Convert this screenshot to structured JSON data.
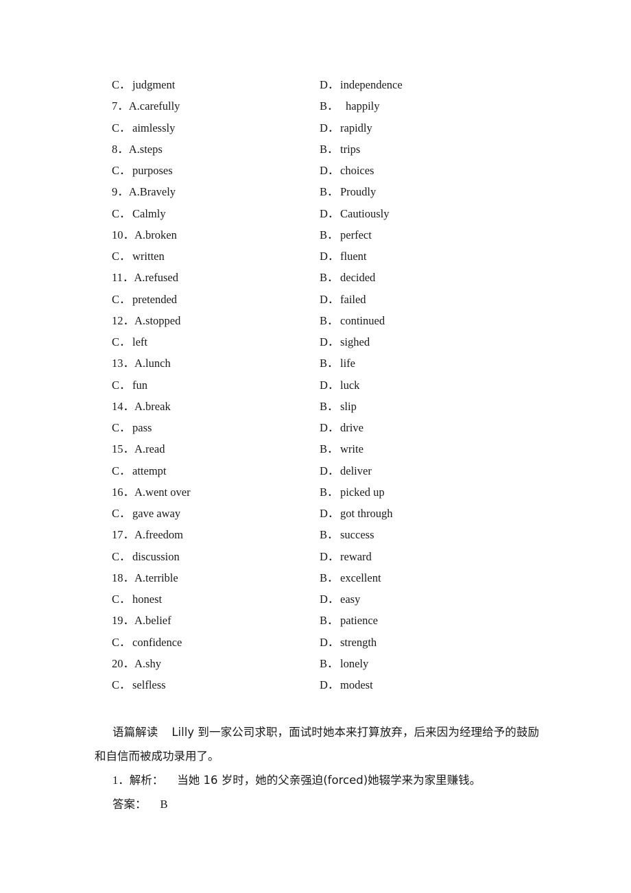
{
  "document": {
    "type": "answer-key-page",
    "background_color": "#ffffff",
    "text_color": "#1a1a1a"
  },
  "options": {
    "rows": [
      {
        "left": {
          "lead": "C．",
          "word": "judgment"
        },
        "right": {
          "lead": "D．",
          "word": "independence"
        }
      },
      {
        "left": {
          "lead": "7．A.",
          "word": "carefully",
          "numbered": true
        },
        "right": {
          "lead": "B．",
          "word": "happily",
          "extra_gap": true
        }
      },
      {
        "left": {
          "lead": "C．",
          "word": "aimlessly"
        },
        "right": {
          "lead": "D．",
          "word": "rapidly"
        }
      },
      {
        "left": {
          "lead": "8．A.",
          "word": "steps",
          "numbered": true
        },
        "right": {
          "lead": "B．",
          "word": "trips"
        }
      },
      {
        "left": {
          "lead": "C．",
          "word": "purposes"
        },
        "right": {
          "lead": "D．",
          "word": "choices"
        }
      },
      {
        "left": {
          "lead": "9．A.",
          "word": "Bravely",
          "numbered": true
        },
        "right": {
          "lead": "B．",
          "word": "Proudly"
        }
      },
      {
        "left": {
          "lead": "C．",
          "word": "Calmly"
        },
        "right": {
          "lead": "D．",
          "word": "Cautiously"
        }
      },
      {
        "left": {
          "lead": "10．A.",
          "word": "broken",
          "numbered": true,
          "two_digit": true
        },
        "right": {
          "lead": "B．",
          "word": "perfect"
        }
      },
      {
        "left": {
          "lead": "C．",
          "word": "written"
        },
        "right": {
          "lead": "D．",
          "word": "fluent"
        }
      },
      {
        "left": {
          "lead": "11．A.",
          "word": "refused",
          "numbered": true,
          "two_digit": true
        },
        "right": {
          "lead": "B．",
          "word": "decided"
        }
      },
      {
        "left": {
          "lead": "C．",
          "word": "pretended"
        },
        "right": {
          "lead": "D．",
          "word": "failed"
        }
      },
      {
        "left": {
          "lead": "12．A.",
          "word": "stopped",
          "numbered": true,
          "two_digit": true
        },
        "right": {
          "lead": "B．",
          "word": "continued"
        }
      },
      {
        "left": {
          "lead": "C．",
          "word": "left"
        },
        "right": {
          "lead": "D．",
          "word": "sighed"
        }
      },
      {
        "left": {
          "lead": "13．A.",
          "word": "lunch",
          "numbered": true,
          "two_digit": true
        },
        "right": {
          "lead": "B．",
          "word": "life"
        }
      },
      {
        "left": {
          "lead": "C．",
          "word": "fun"
        },
        "right": {
          "lead": "D．",
          "word": "luck"
        }
      },
      {
        "left": {
          "lead": "14．A.",
          "word": "break",
          "numbered": true,
          "two_digit": true
        },
        "right": {
          "lead": "B．",
          "word": "slip"
        }
      },
      {
        "left": {
          "lead": "C．",
          "word": "pass"
        },
        "right": {
          "lead": "D．",
          "word": "drive"
        }
      },
      {
        "left": {
          "lead": "15．A.",
          "word": "read",
          "numbered": true,
          "two_digit": true
        },
        "right": {
          "lead": "B．",
          "word": "write"
        }
      },
      {
        "left": {
          "lead": "C．",
          "word": "attempt"
        },
        "right": {
          "lead": "D．",
          "word": "deliver"
        }
      },
      {
        "left": {
          "lead": "16．A.",
          "word": "went over",
          "numbered": true,
          "two_digit": true
        },
        "right": {
          "lead": "B．",
          "word": "picked up"
        }
      },
      {
        "left": {
          "lead": "C．",
          "word": "gave away"
        },
        "right": {
          "lead": "D．",
          "word": "got through"
        }
      },
      {
        "left": {
          "lead": "17．A.",
          "word": "freedom",
          "numbered": true,
          "two_digit": true
        },
        "right": {
          "lead": "B．",
          "word": "success"
        }
      },
      {
        "left": {
          "lead": "C．",
          "word": "discussion"
        },
        "right": {
          "lead": "D．",
          "word": "reward"
        }
      },
      {
        "left": {
          "lead": "18．A.",
          "word": "terrible",
          "numbered": true,
          "two_digit": true
        },
        "right": {
          "lead": "B．",
          "word": "excellent"
        }
      },
      {
        "left": {
          "lead": "C．",
          "word": "honest"
        },
        "right": {
          "lead": "D．",
          "word": "easy"
        }
      },
      {
        "left": {
          "lead": "19．A.",
          "word": "belief",
          "numbered": true,
          "two_digit": true
        },
        "right": {
          "lead": "B．",
          "word": "patience"
        }
      },
      {
        "left": {
          "lead": "C．",
          "word": "confidence"
        },
        "right": {
          "lead": "D．",
          "word": "strength"
        }
      },
      {
        "left": {
          "lead": "20．A.",
          "word": "shy",
          "numbered": true,
          "two_digit": true
        },
        "right": {
          "lead": "B．",
          "word": "lonely"
        }
      },
      {
        "left": {
          "lead": "C．",
          "word": "selfless"
        },
        "right": {
          "lead": "D．",
          "word": "modest"
        }
      }
    ]
  },
  "explanation": {
    "passage_label": "语篇解读",
    "passage_text": "Lilly 到一家公司求职，面试时她本来打算放弃，后来因为经理给予的鼓励和自信而被成功录用了。",
    "item_number": "1．",
    "analysis_label": "解析：",
    "analysis_text": "当她 16 岁时，她的父亲强迫(forced)她辍学来为家里赚钱。",
    "answer_label": "答案：",
    "answer_value": "B"
  }
}
